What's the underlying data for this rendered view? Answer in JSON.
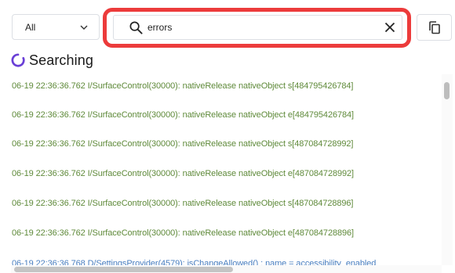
{
  "filter": {
    "selected": "All"
  },
  "search": {
    "value": "errors",
    "placeholder": ""
  },
  "status": {
    "text": "Searching"
  },
  "log_lines": [
    "06-19 22:36:36.762 I/SurfaceControl(30000): nativeRelease nativeObject s[484795426784]",
    "06-19 22:36:36.762 I/SurfaceControl(30000): nativeRelease nativeObject e[484795426784]",
    "06-19 22:36:36.762 I/SurfaceControl(30000): nativeRelease nativeObject s[487084728992]",
    "06-19 22:36:36.762 I/SurfaceControl(30000): nativeRelease nativeObject e[487084728992]",
    "06-19 22:36:36.762 I/SurfaceControl(30000): nativeRelease nativeObject s[487084728896]",
    "06-19 22:36:36.762 I/SurfaceControl(30000): nativeRelease nativeObject e[487084728896]",
    "06-19 22:36:36.768 D/SettingsProvider(4579): isChangeAllowed() : name = accessibility_enabled"
  ],
  "colors": {
    "highlight": "#ec3b3b",
    "info_log": "#5f8a3a",
    "debug_log": "#4a7fc0",
    "spinner": "#6a3fd6"
  },
  "icons": {
    "filter": "chevron-down-icon",
    "search": "search-icon",
    "clear": "close-icon",
    "copy": "copy-icon",
    "status": "spinner-icon"
  }
}
